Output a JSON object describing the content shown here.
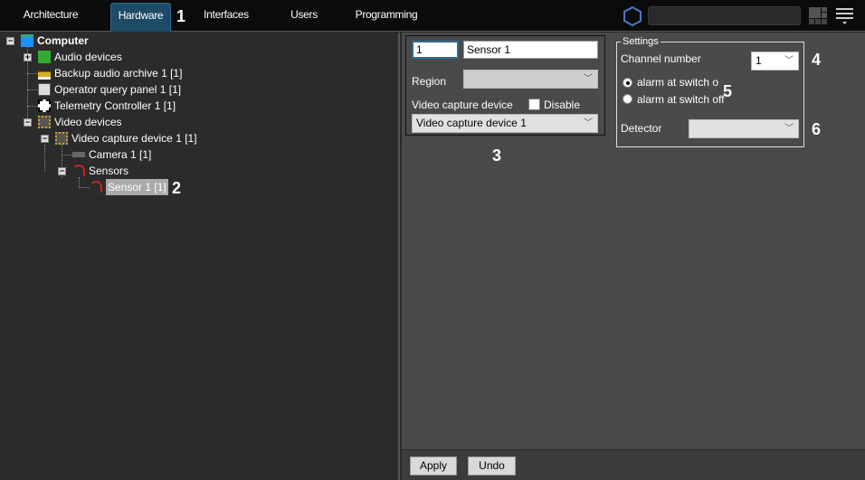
{
  "tabs": [
    {
      "label": "Architecture"
    },
    {
      "label": "Hardware"
    },
    {
      "label": "Interfaces"
    },
    {
      "label": "Users"
    },
    {
      "label": "Programming"
    }
  ],
  "callouts": {
    "n1": "1",
    "n2": "2",
    "n3": "3",
    "n4": "4",
    "n5": "5",
    "n6": "6"
  },
  "tree": {
    "computer": "Computer",
    "audio": "Audio devices",
    "backup": "Backup audio archive 1 [1]",
    "operator": "Operator query panel 1 [1]",
    "telemetry": "Telemetry Controller 1 [1]",
    "video": "Video devices",
    "capture": "Video capture device 1 [1]",
    "camera": "Camera 1 [1]",
    "sensors": "Sensors",
    "sensor1": "Sensor 1 [1]"
  },
  "form": {
    "id_value": "1",
    "name_value": "Sensor 1",
    "region_label": "Region",
    "region_value": "",
    "vcd_label": "Video capture device",
    "disable_label": "Disable",
    "disable_checked": false,
    "vcd_value": "Video capture device 1"
  },
  "settings": {
    "title": "Settings",
    "channel_label": "Channel number",
    "channel_value": "1",
    "radio_on": "alarm at switch o",
    "radio_off": "alarm at switch off",
    "detector_label": "Detector",
    "detector_value": ""
  },
  "footer": {
    "apply": "Apply",
    "undo": "Undo"
  },
  "colors": {
    "active_tab": "#1d4a66",
    "panel": "#4a4a4a",
    "tree_bg": "#2b2b2b"
  }
}
